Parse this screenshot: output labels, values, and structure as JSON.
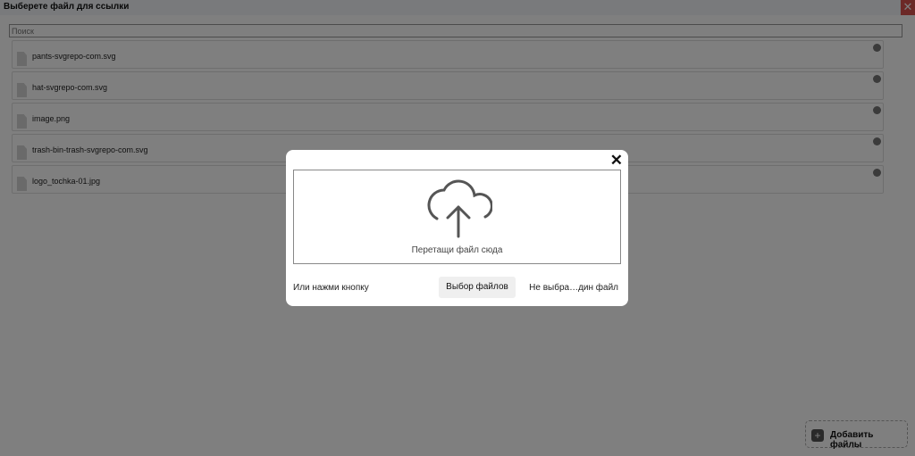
{
  "window": {
    "title": "Выберете файл для ссылки",
    "close_glyph": "✕"
  },
  "search": {
    "placeholder": "Поиск",
    "value": ""
  },
  "files": [
    {
      "name": "pants-svgrepo-com.svg",
      "icon": "file-icon"
    },
    {
      "name": "hat-svgrepo-com.svg",
      "icon": "file-icon"
    },
    {
      "name": "image.png",
      "icon": "file-icon"
    },
    {
      "name": "trash-bin-trash-svgrepo-com.svg",
      "icon": "file-icon"
    },
    {
      "name": "logo_tochka-01.jpg",
      "icon": "file-icon"
    }
  ],
  "add_files": {
    "plus_glyph": "+",
    "label": "Добавить файлы"
  },
  "upload_modal": {
    "close_glyph": "✕",
    "drop_text": "Перетащи файл сюда",
    "drop_icon": "cloud-upload-icon",
    "or_text": "Или нажми кнопку",
    "choose_button": "Выбор файлов",
    "no_file_text": "Не выбра…дин файл"
  },
  "colors": {
    "overlay": "#000000",
    "close_button": "#d9534f"
  }
}
